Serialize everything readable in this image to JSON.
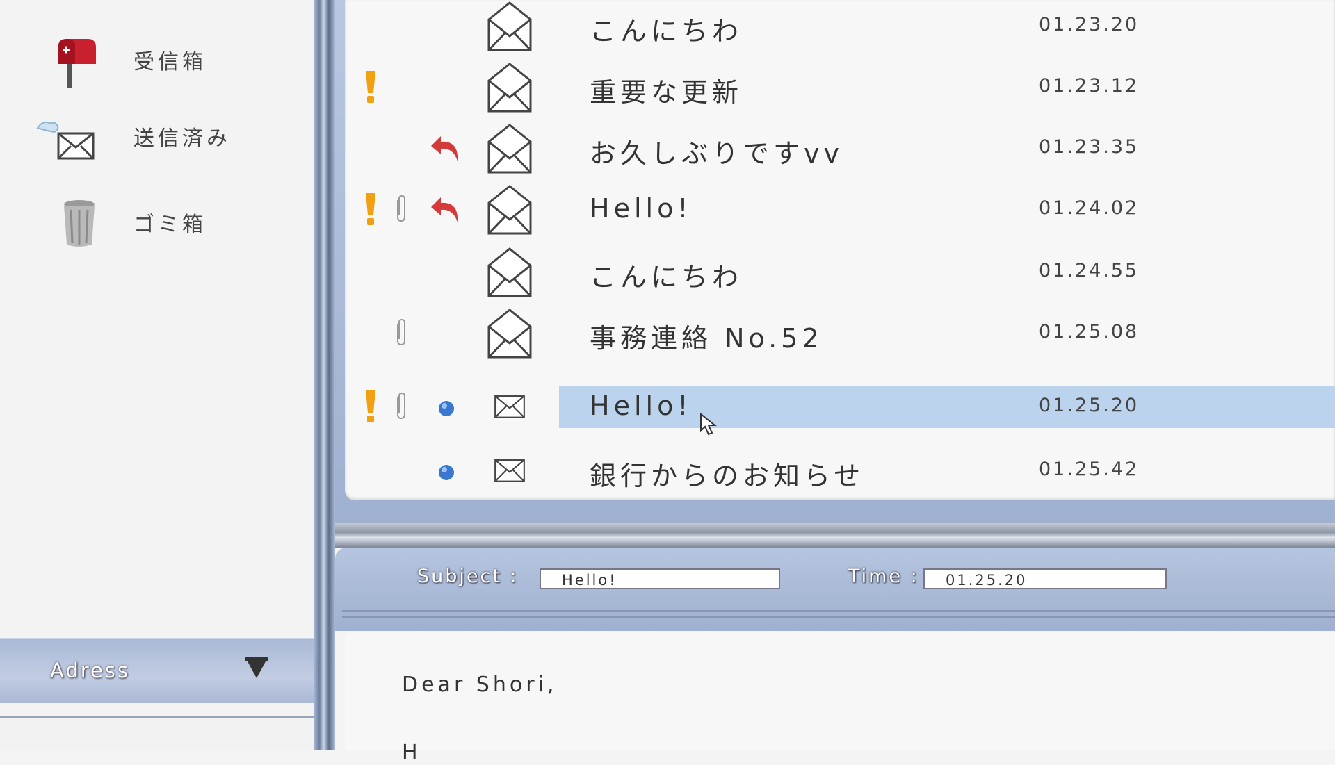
{
  "sidebar": {
    "folders": [
      {
        "label": "受信箱",
        "icon": "mailbox-icon"
      },
      {
        "label": "送信済み",
        "icon": "winged-envelope-icon"
      },
      {
        "label": "ゴミ箱",
        "icon": "trash-can-icon"
      }
    ],
    "address_label": "Adress"
  },
  "mail_list": [
    {
      "subject": "こんにちわ",
      "time": "01.23.20",
      "important": false,
      "attachment": false,
      "replied": false,
      "unread": false,
      "selected": false
    },
    {
      "subject": "重要な更新",
      "time": "01.23.12",
      "important": true,
      "attachment": false,
      "replied": false,
      "unread": false,
      "selected": false
    },
    {
      "subject": "お久しぶりですvv",
      "time": "01.23.35",
      "important": false,
      "attachment": false,
      "replied": true,
      "unread": false,
      "selected": false
    },
    {
      "subject": "Hello!",
      "time": "01.24.02",
      "important": true,
      "attachment": true,
      "replied": true,
      "unread": false,
      "selected": false
    },
    {
      "subject": "こんにちわ",
      "time": "01.24.55",
      "important": false,
      "attachment": false,
      "replied": false,
      "unread": false,
      "selected": false
    },
    {
      "subject": "事務連絡 No.52",
      "time": "01.25.08",
      "important": false,
      "attachment": true,
      "replied": false,
      "unread": false,
      "selected": false
    },
    {
      "subject": "Hello!",
      "time": "01.25.20",
      "important": true,
      "attachment": true,
      "replied": false,
      "unread": true,
      "selected": true
    },
    {
      "subject": "銀行からのお知らせ",
      "time": "01.25.42",
      "important": false,
      "attachment": false,
      "replied": false,
      "unread": true,
      "selected": false
    }
  ],
  "preview": {
    "subject_label": "Subject :",
    "subject_value": "Hello!",
    "time_label": "Time :",
    "time_value": "01.25.20",
    "body_lines": [
      "Dear  Shori,",
      "H"
    ]
  },
  "colors": {
    "selection": "#bcd3ee",
    "important": "#f0a010",
    "reply_arrow": "#d43a3a",
    "unread_dot": "#3a78d0"
  }
}
